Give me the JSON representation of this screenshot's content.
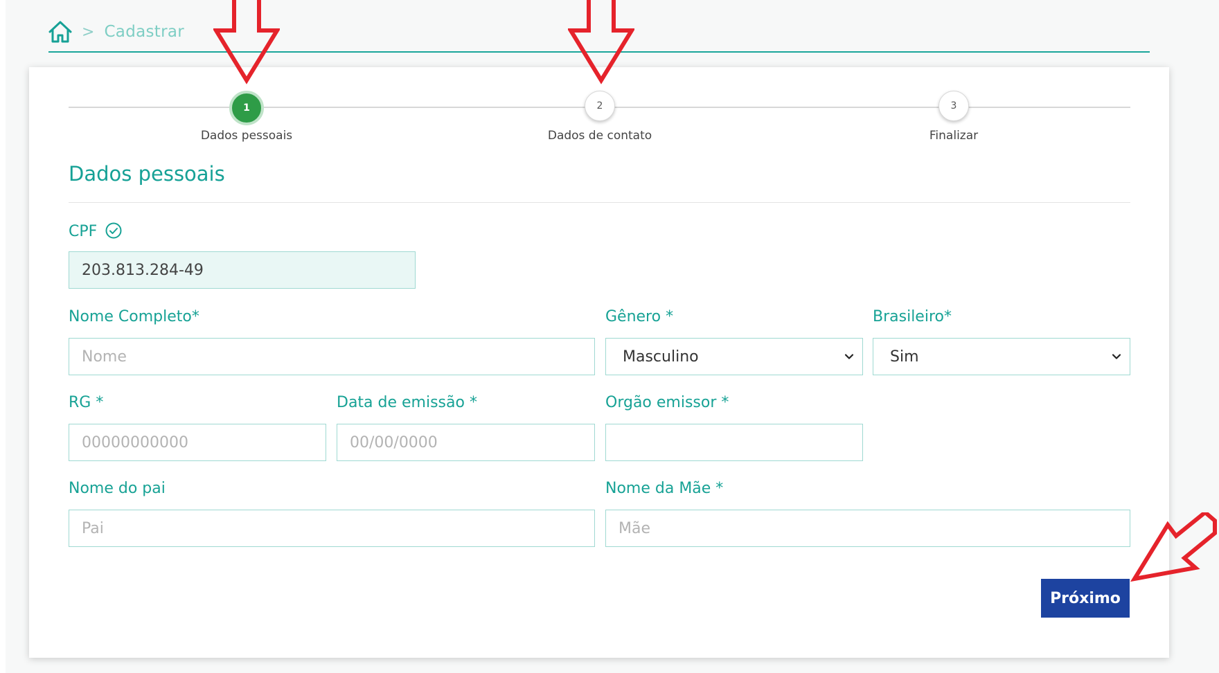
{
  "breadcrumb": {
    "separator": ">",
    "current": "Cadastrar"
  },
  "stepper": {
    "steps": [
      {
        "number": "1",
        "label": "Dados pessoais",
        "state": "active"
      },
      {
        "number": "2",
        "label": "Dados de contato",
        "state": "pending"
      },
      {
        "number": "3",
        "label": "Finalizar",
        "state": "pending"
      }
    ]
  },
  "section": {
    "title": "Dados pessoais"
  },
  "form": {
    "cpf": {
      "label": "CPF",
      "value": "203.813.284-49"
    },
    "nome_completo": {
      "label": "Nome Completo*",
      "placeholder": "Nome"
    },
    "genero": {
      "label": "Gênero *",
      "selected": "Masculino"
    },
    "brasileiro": {
      "label": "Brasileiro*",
      "selected": "Sim"
    },
    "rg": {
      "label": "RG *",
      "placeholder": "00000000000"
    },
    "data_emissao": {
      "label": "Data de emissão *",
      "placeholder": "00/00/0000"
    },
    "orgao_emissor": {
      "label": "Orgão emissor *",
      "placeholder": ""
    },
    "nome_pai": {
      "label": "Nome do pai",
      "placeholder": "Pai"
    },
    "nome_mae": {
      "label": "Nome da Mãe *",
      "placeholder": "Mãe"
    }
  },
  "actions": {
    "next_label": "Próximo"
  },
  "colors": {
    "accent": "#17a295",
    "step_active": "#2e9c47",
    "button": "#1d43a0",
    "annotation_arrow": "#e5232b"
  },
  "icons": [
    "home-icon",
    "check-circle-icon",
    "chevron-down-icon",
    "arrow-annotation"
  ]
}
